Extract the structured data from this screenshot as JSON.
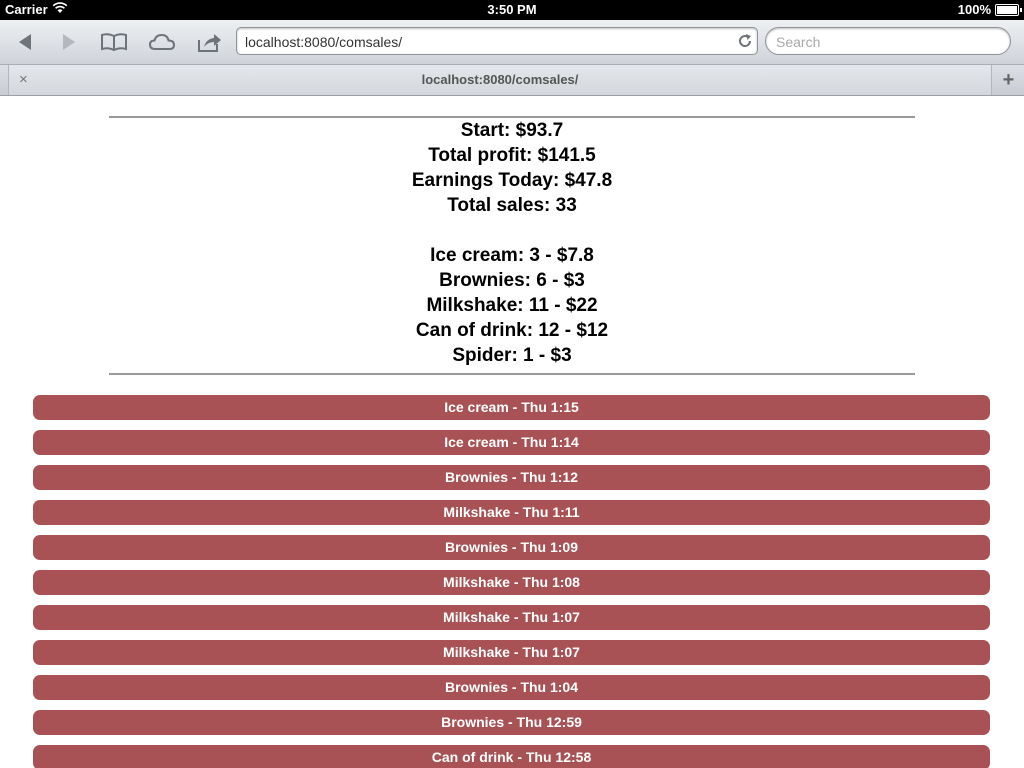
{
  "status_bar": {
    "carrier": "Carrier",
    "time": "3:50 PM",
    "battery": "100%"
  },
  "browser": {
    "url": "localhost:8080/comsales/",
    "search_placeholder": "Search",
    "tab_title": "localhost:8080/comsales/",
    "tab_close": "×",
    "tab_add": "+"
  },
  "summary": {
    "start": "Start: $93.7",
    "total_profit": "Total profit: $141.5",
    "earnings_today": "Earnings Today: $47.8",
    "total_sales": "Total sales: 33"
  },
  "items": [
    "Ice cream: 3 - $7.8",
    "Brownies: 6 - $3",
    "Milkshake: 11 - $22",
    "Can of drink: 12 - $12",
    "Spider: 1 - $3"
  ],
  "sales": [
    "Ice cream - Thu 1:15",
    "Ice cream - Thu 1:14",
    "Brownies - Thu 1:12",
    "Milkshake - Thu 1:11",
    "Brownies - Thu 1:09",
    "Milkshake - Thu 1:08",
    "Milkshake - Thu 1:07",
    "Milkshake - Thu 1:07",
    "Brownies - Thu 1:04",
    "Brownies - Thu 12:59",
    "Can of drink - Thu 12:58"
  ],
  "colors": {
    "sale_button": "#a85255"
  },
  "icons": {
    "back": "back-arrow-icon",
    "forward": "forward-arrow-icon",
    "bookmarks": "book-icon",
    "icloud": "cloud-icon",
    "share": "share-icon",
    "reload": "reload-icon",
    "wifi": "wifi-icon",
    "battery": "battery-icon"
  }
}
